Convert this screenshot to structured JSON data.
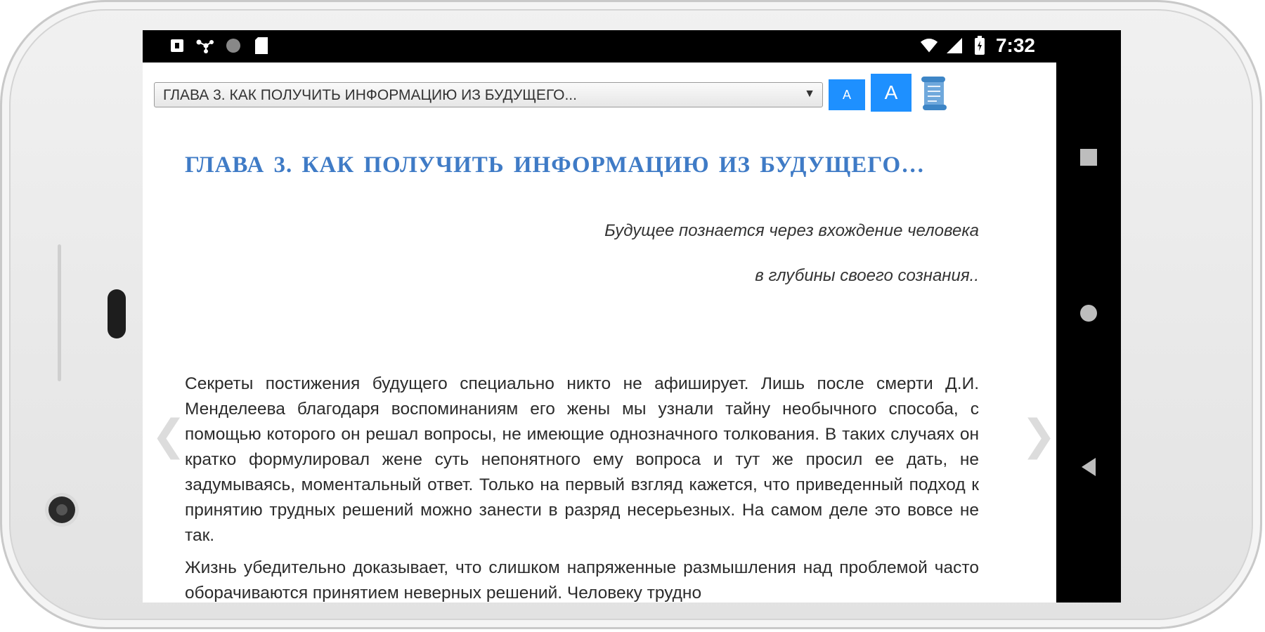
{
  "status_bar": {
    "time": "7:32",
    "left_icons": [
      "notification-icon",
      "share-icon",
      "circle-icon",
      "sd-card-icon"
    ],
    "right_icons": [
      "wifi-icon",
      "signal-icon",
      "battery-icon"
    ]
  },
  "toolbar": {
    "chapter_selected": "ГЛАВА 3. КАК ПОЛУЧИТЬ ИНФОРМАЦИЮ ИЗ БУДУЩЕГО...",
    "font_small_label": "A",
    "font_large_label": "A",
    "scroll_icon": "scroll-icon"
  },
  "book": {
    "chapter_title": "ГЛАВА  3.  КАК ПОЛУЧИТЬ ИНФОРМАЦИЮ ИЗ БУДУЩЕГО…",
    "epigraph_line1": "Будущее познается через вхождение человека",
    "epigraph_line2": "в глубины своего сознания..",
    "paragraph1": "Секреты постижения будущего специально никто не афиширует. Лишь после смерти Д.И. Менделеева благодаря воспоминаниям его жены мы узнали тайну необычного способа, с помощью которого он решал вопросы, не имеющие однозначного толкования. В таких случаях он кратко формулировал жене суть непонятного ему вопроса и тут же просил ее дать, не задумываясь, моментальный ответ. Только на первый взгляд кажется, что приведенный подход к принятию трудных решений можно занести в разряд несерьезных. На самом деле это вовсе не так.",
    "paragraph2": "Жизнь убедительно доказывает, что слишком напряженные размышления над проблемой часто оборачиваются принятием неверных решений. Человеку трудно"
  },
  "navigation": {
    "prev_page_glyph": "❮",
    "next_page_glyph": "❯"
  }
}
